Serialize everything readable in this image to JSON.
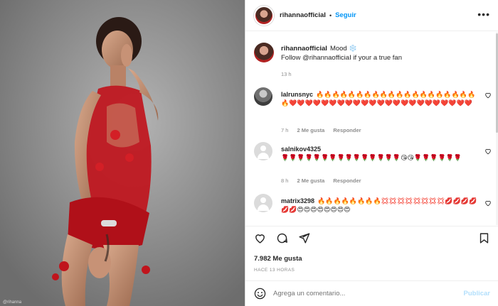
{
  "header": {
    "username": "rihannaofficiaI",
    "follow_label": "Seguir",
    "separator": "•",
    "more_label": "•••"
  },
  "caption": {
    "username": "rihannaofficiaI",
    "text_line1": "Mood ❄️",
    "text_line2": "Follow @rihannaofficiaI if your a true fan",
    "time": "13 h"
  },
  "comments": [
    {
      "username": "lalrunsnyc",
      "text": "🔥🔥🔥🔥🔥🔥🔥🔥🔥🔥🔥🔥🔥🔥🔥🔥🔥🔥🔥🔥🔥❤️❤️❤️❤️❤️❤️❤️❤️❤️❤️❤️❤️❤️❤️❤️❤️❤️❤️❤️❤️❤️❤️❤️",
      "time": "7 h",
      "likes": "2 Me gusta",
      "reply": "Responder"
    },
    {
      "username": "salnikov4325",
      "text": "🌹🌹🌹🌹🌹🌹🌹🌹🌹🌹🌹🌹🌹🌹🌹😘😘🌹🌹🌹🌹🌹🌹",
      "time": "8 h",
      "likes": "2 Me gusta",
      "reply": "Responder"
    },
    {
      "username": "matrix3298",
      "text": "🔥🔥🔥🔥🔥🔥🔥🔥💢💢💢💢💢💢💢💢💋💋💋💋💋💋😍😍😍😍😍😍😍😍"
    }
  ],
  "actions": {
    "likes": "7.982 Me gusta",
    "posted": "HACE 13 HORAS",
    "comment_placeholder": "Agrega un comentario...",
    "publish_label": "Publicar"
  },
  "colors": {
    "link_blue": "#0095f6",
    "publish_disabled": "#b2dffc",
    "secondary_text": "#8e8e8e",
    "dress_red": "#c0141c"
  },
  "photo": {
    "credit": "@rihanna"
  }
}
